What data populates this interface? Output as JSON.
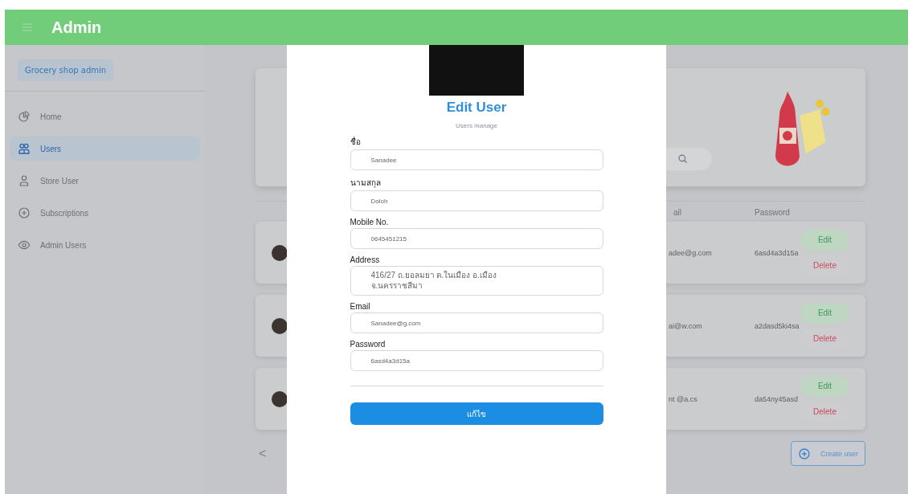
{
  "header": {
    "title": "Admin"
  },
  "sidebar": {
    "brand": "Grocery shop admin",
    "items": [
      {
        "label": "Home",
        "selected": false
      },
      {
        "label": "Users",
        "selected": true
      },
      {
        "label": "Store User",
        "selected": false
      },
      {
        "label": "Subscriptions",
        "selected": false
      },
      {
        "label": "Admin Users",
        "selected": false
      }
    ]
  },
  "main": {
    "table": {
      "columns": [
        "ail",
        "Password"
      ],
      "rows": [
        {
          "email": "adee@g.com",
          "password": "6asd4a3d15a",
          "edit": "Edit",
          "delete": "Delete"
        },
        {
          "email": "ai@w.com",
          "password": "a2dasd5ki4sa",
          "edit": "Edit",
          "delete": "Delete"
        },
        {
          "email": "nt @a.cs",
          "password": "da54ny45asd",
          "edit": "Edit",
          "delete": "Delete"
        }
      ]
    },
    "pagination": {
      "prev": "<"
    },
    "create_button": "Create user"
  },
  "modal": {
    "title": "Edit User",
    "subtitle": "Users manage",
    "fields": [
      {
        "label": "ชื่อ",
        "value": "Sanadee"
      },
      {
        "label": "นามสกุล",
        "value": "Doloh"
      },
      {
        "label": "Mobile No.",
        "value": "0645451215"
      },
      {
        "label": "Address",
        "value": "416/27 ถ.ยอลมยา ต.ในเมือง อ.เมือง\nจ.นครราชสีมา"
      },
      {
        "label": "Email",
        "value": "Sanadee@g.com"
      },
      {
        "label": "Password",
        "value": "6asd4a3d15a"
      }
    ],
    "submit": "แก้ไข"
  }
}
